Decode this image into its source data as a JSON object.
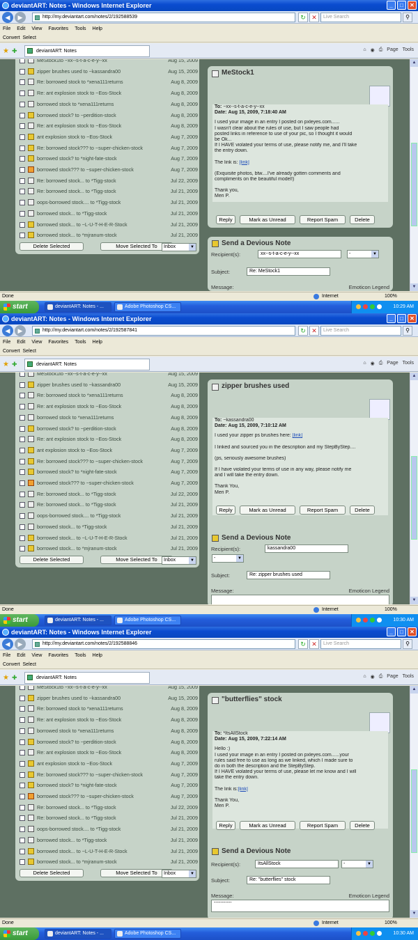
{
  "window_title": "deviantART: Notes - Windows Internet Explorer",
  "search_placeholder": "Live Search",
  "menu": [
    "File",
    "Edit",
    "View",
    "Favorites",
    "Tools",
    "Help"
  ],
  "links": [
    "Convert",
    "Select"
  ],
  "tab_title": "deviantART: Notes",
  "tools_items": [
    "Page",
    "Tools"
  ],
  "status": {
    "done": "Done",
    "zone": "Internet",
    "zoom": "100%"
  },
  "taskbar": {
    "start": "start",
    "task1": "deviantART: Notes - ...",
    "task2": "Adobe Photoshop CS..."
  },
  "notes_list": [
    {
      "subject": "MeStock1to ~xx--s-t-a-c-e-y--xx",
      "date": "Aug 15, 2009",
      "icon": "plain"
    },
    {
      "subject": "zipper brushes used to ~kassandra00",
      "date": "Aug 15, 2009",
      "icon": "yellow"
    },
    {
      "subject": "Re: borrowed stock to *xena111returns",
      "date": "Aug 8, 2009",
      "icon": "plain"
    },
    {
      "subject": "Re: ant explosion stock to ~Eos-Stock",
      "date": "Aug 8, 2009",
      "icon": "plain"
    },
    {
      "subject": "borrowed stock to *xena111returns",
      "date": "Aug 8, 2009",
      "icon": "plain"
    },
    {
      "subject": "borrowed stock? to ~perdition-stock",
      "date": "Aug 8, 2009",
      "icon": "yellow"
    },
    {
      "subject": "Re: ant explosion stock to ~Eos-Stock",
      "date": "Aug 8, 2009",
      "icon": "plain"
    },
    {
      "subject": "ant explosion stock to ~Eos-Stock",
      "date": "Aug 7, 2009",
      "icon": "yellow"
    },
    {
      "subject": "Re: borrowed stock??? to ~super-chicken-stock",
      "date": "Aug 7, 2009",
      "icon": "yellow"
    },
    {
      "subject": "borrowed stock? to *night-fate-stock",
      "date": "Aug 7, 2009",
      "icon": "yellow"
    },
    {
      "subject": "borrowed stock??? to ~super-chicken-stock",
      "date": "Aug 7, 2009",
      "icon": "orange"
    },
    {
      "subject": "Re: borrowed stock... to *Tigg-stock",
      "date": "Jul 22, 2009",
      "icon": "plain"
    },
    {
      "subject": "Re: borrowed stock... to *Tigg-stock",
      "date": "Jul 21, 2009",
      "icon": "plain"
    },
    {
      "subject": "oops-borrowed stock.... to *Tigg-stock",
      "date": "Jul 21, 2009",
      "icon": "plain"
    },
    {
      "subject": "borrowed stock... to *Tigg-stock",
      "date": "Jul 21, 2009",
      "icon": "plain"
    },
    {
      "subject": "borrowed stock... to ~L-U-T-H-E-R-Stock",
      "date": "Jul 21, 2009",
      "icon": "yellow"
    },
    {
      "subject": "borrowed stock... to *mjranum-stock",
      "date": "Jul 21, 2009",
      "icon": "yellow"
    }
  ],
  "list_buttons": {
    "delete": "Delete Selected",
    "move": "Move Selected To",
    "folder": "Inbox"
  },
  "note_buttons": {
    "reply": "Reply",
    "unread": "Mark as Unread",
    "spam": "Report Spam",
    "delete": "Delete"
  },
  "send": {
    "title": "Send a Devious Note",
    "recipient_label": "Recipient(s):",
    "subject_label": "Subject:",
    "message_label": "Message:",
    "emoticon": "Emoticon Legend",
    "dd": "-"
  },
  "shots": [
    {
      "url": "http://my.deviantart.com/notes/2/192588539",
      "clock": "10:29 AM",
      "note_title": "MeStock1",
      "to_label": "To:",
      "to": "~xx--s-t-a-c-e-y--xx",
      "date_label": "Date:",
      "date": "Aug 15, 2009, 7:18:40 AM",
      "body": [
        "I used your image in an entry I posted on pxleyes.com......",
        "I wasn't clear about the rules of use, but I saw people had",
        "posted links in reference to use of your pic, so I thought it would",
        "be Ok...",
        "If I HAVE violated your terms of use, please notify me, and I'll take",
        "the entry down.",
        "",
        "The link is: [link]",
        "",
        "(Exquisite photos, btw....I've already gotten comments and",
        "compliments on the beautiful model!)",
        "",
        "Thank you,",
        "Meri P."
      ],
      "link_text": "[link]",
      "recipient": "xx--s-t-a-c-e-y--xx",
      "subject": "Re: MeStock1",
      "message": ""
    },
    {
      "url": "http://my.deviantart.com/notes/2/192587841",
      "clock": "10:30 AM",
      "note_title": "zipper brushes used",
      "to_label": "To:",
      "to": "~kassandra00",
      "date_label": "Date:",
      "date": "Aug 15, 2009, 7:10:12 AM",
      "body": [
        "I used your zipper ps brushes here: [link]",
        "",
        "I linked and sourced you in the description and my StepByStep....",
        "",
        "(ps, seriously awesome brushes)",
        "",
        "If I have violated your terms of use in any way, please notify me",
        "and I will take the entry down.",
        "",
        "Thank You,",
        "Meri P."
      ],
      "link_text": "[link]",
      "recipient": "kassandra00",
      "subject": "Re: zipper brushes used",
      "message": ""
    },
    {
      "url": "http://my.deviantart.com/notes/2/192588846",
      "clock": "10:30 AM",
      "note_title": "\"butterflies\" stock",
      "to_label": "To:",
      "to": "*ItsAllStock",
      "date_label": "Date:",
      "date": "Aug 15, 2009, 7:22:14 AM",
      "body": [
        "Hello :)",
        "I used your image in an entry I posted on pxleyes.com......your",
        "rules said free to use as long as we linked, which I made sure to",
        "do in both the description and the StepByStep.",
        "If I HAVE violated your terms of use, please let me know and I will",
        "take the entry down.",
        "",
        "The link is:[link]",
        "",
        "Thank You,",
        "Meri P."
      ],
      "link_text": "[link]",
      "recipient": "ItsAllStock",
      "subject": "Re: \"butterflies\" stock",
      "message": "-----------"
    }
  ]
}
